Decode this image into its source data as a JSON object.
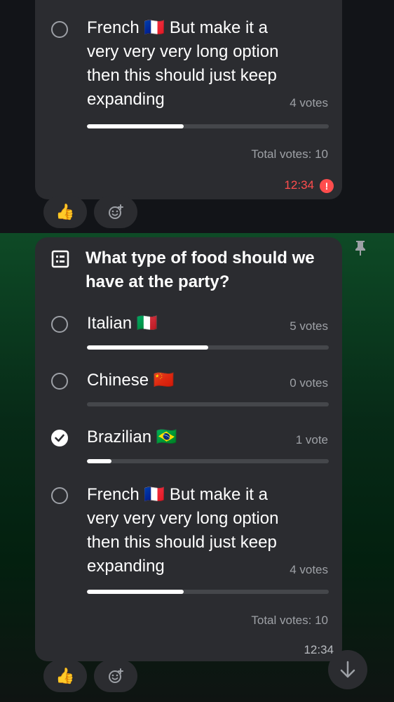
{
  "top_message": {
    "option": {
      "label": "French 🇫🇷 But make it a very very very long option then this should just keep expanding",
      "votes": "4 votes",
      "fill": 0.4
    },
    "total": "Total votes: 10",
    "time": "12:34",
    "error_mark": "!",
    "reactions": {
      "thumbs": "👍"
    }
  },
  "poll": {
    "question": "What type of food should we have at the party?",
    "options": [
      {
        "label": "Italian 🇮🇹",
        "votes": "5 votes",
        "fill": 0.5,
        "checked": false
      },
      {
        "label": "Chinese 🇨🇳",
        "votes": "0 votes",
        "fill": 0,
        "checked": false
      },
      {
        "label": "Brazilian 🇧🇷",
        "votes": "1 vote",
        "fill": 0.1,
        "checked": true
      },
      {
        "label": "French 🇫🇷 But make it a very very very long option then this should just keep expanding",
        "votes": "4 votes",
        "fill": 0.4,
        "checked": false
      }
    ],
    "total": "Total votes: 10",
    "time": "12:34",
    "reactions": {
      "thumbs": "👍"
    }
  }
}
